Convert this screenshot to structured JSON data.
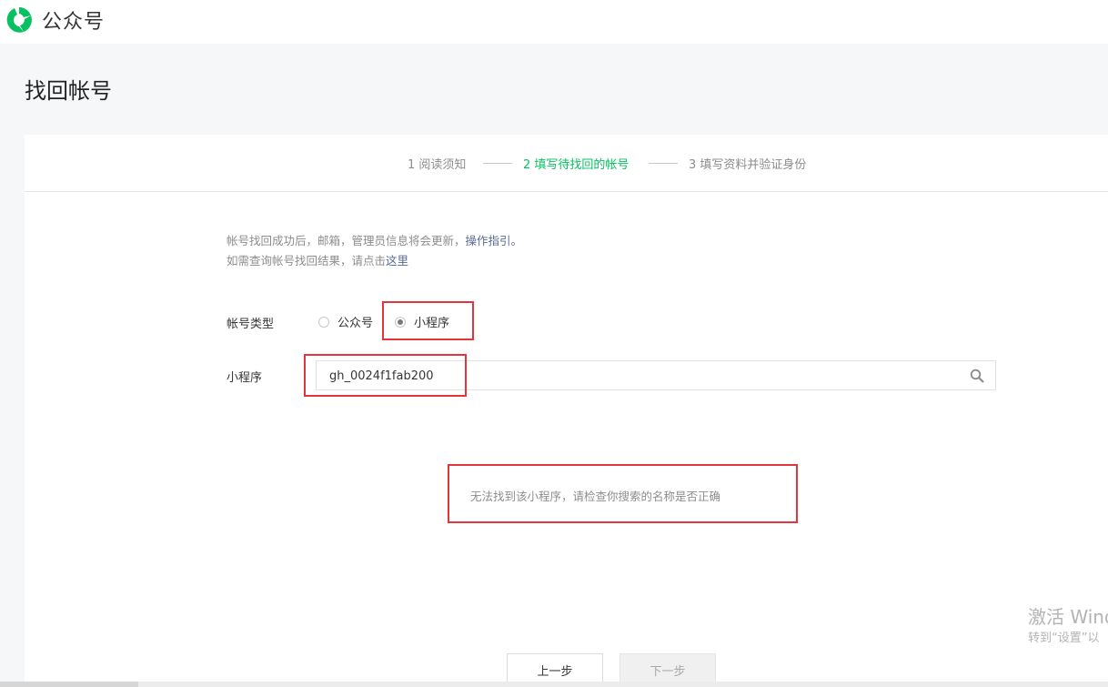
{
  "header": {
    "brand": "公众号",
    "logo_icon": "wechat-official-account-logo"
  },
  "page": {
    "title": "找回帐号"
  },
  "steps": [
    {
      "label": "1 阅读须知",
      "active": false
    },
    {
      "label": "2 填写待找回的帐号",
      "active": true
    },
    {
      "label": "3 填写资料并验证身份",
      "active": false
    }
  ],
  "notice": {
    "line1": "帐号找回成功后，邮箱，管理员信息将会更新，",
    "guide_link": "操作指引。",
    "line2": "如需查询帐号找回结果，请点击",
    "here_link": "这里"
  },
  "form": {
    "type_label": "帐号类型",
    "options": [
      {
        "label": "公众号",
        "checked": false
      },
      {
        "label": "小程序",
        "checked": true
      }
    ],
    "field_label": "小程序",
    "search_value": "gh_0024f1fab200",
    "search_icon": "search-icon"
  },
  "error": {
    "message": "无法找到该小程序，请检查你搜索的名称是否正确"
  },
  "buttons": {
    "prev": "上一步",
    "next": "下一步"
  },
  "watermark": {
    "line1": "激活 Wind",
    "line2": "转到“设置”以"
  },
  "colors": {
    "accent": "#07c160",
    "link": "#576b95",
    "highlight": "#e3353e"
  }
}
